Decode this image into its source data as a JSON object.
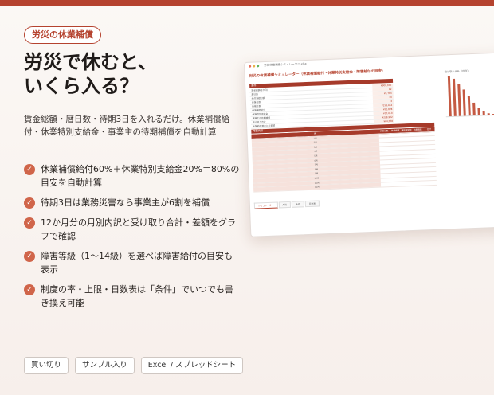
{
  "tag": "労災の休業補償",
  "headline": [
    "労災で休むと、",
    "いくら入る？"
  ],
  "description": "賃金総額・暦日数・待期3日を入れるだけ。休業補償給付・休業特別支給金・事業主の待期補償を自動計算",
  "features": [
    "休業補償給付60%＋休業特別支給金20%＝80%の目安を自動計算",
    "待期3日は業務災害なら事業主が6割を補償",
    "12か月分の月別内訳と受け取り合計・差額をグラフで確認",
    "障害等級（1〜14級）を選べば障害給付の目安も表示",
    "制度の率・上限・日数表は「条件」でいつでも書き換え可能"
  ],
  "badges": [
    "買い切り",
    "サンプル入り",
    "Excel / スプレッドシート"
  ],
  "colors": {
    "accent": "#b5432f",
    "check": "#d0654a",
    "bar": "#c55a43"
  },
  "icons": {
    "feature": "check-circle-icon"
  },
  "mockup": {
    "filename": "労災休業補償シミュレーター.xlsx",
    "sheet_title": "労災の休業補償シミュレーター（休業補償給付・休業特別支給金・障害給付の目安）",
    "input_header": "条件",
    "params": [
      {
        "label": "賃金総額(3か月)",
        "value": "¥900,000"
      },
      {
        "label": "暦日数",
        "value": "92"
      },
      {
        "label": "給付基礎日額",
        "value": "¥9,783"
      },
      {
        "label": "休業日数",
        "value": "30"
      },
      {
        "label": "待期日数",
        "value": "3"
      },
      {
        "label": "休業補償給付",
        "value": "¥158,484"
      },
      {
        "label": "休業特別支給金",
        "value": "¥52,828"
      },
      {
        "label": "事業主の待期補償",
        "value": "¥17,610"
      },
      {
        "label": "受け取り合計",
        "value": "¥228,922"
      },
      {
        "label": "休業前の賃金との差額",
        "value": "¥64,568"
      }
    ],
    "monthly_header": "月別内訳",
    "monthly_columns": [
      "月",
      "休業日数",
      "休業補償",
      "特別支給金",
      "待期補償",
      "合計"
    ],
    "monthly_rows": [
      "1月",
      "2月",
      "3月",
      "4月",
      "5月",
      "6月",
      "7月",
      "8月",
      "9月",
      "10月",
      "11月",
      "12月"
    ],
    "chart_title": "受け取り合計（月別）",
    "chart_values": [
      100,
      92,
      78,
      64,
      48,
      32,
      18,
      9,
      4,
      2,
      1,
      0
    ],
    "sheet_tabs": [
      "シミュレーター",
      "月別",
      "条件",
      "日数表"
    ]
  }
}
